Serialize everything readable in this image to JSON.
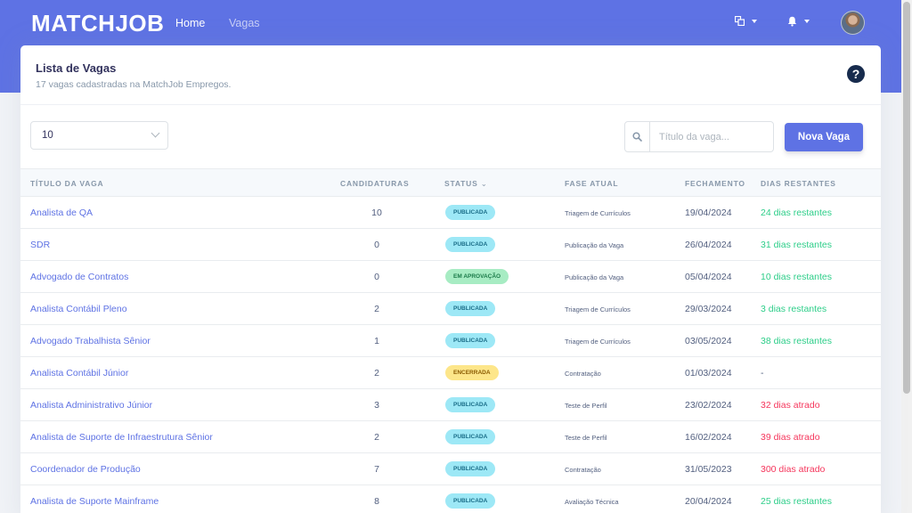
{
  "brand": "MATCHJOB",
  "nav": {
    "home": "Home",
    "vagas": "Vagas"
  },
  "header": {
    "title": "Lista de Vagas",
    "subtitle": "17 vagas cadastradas na MatchJob Empregos."
  },
  "controls": {
    "per_page": "10",
    "search_placeholder": "Título da vaga...",
    "new_button": "Nova Vaga"
  },
  "table": {
    "headers": {
      "title": "TÍTULO DA VAGA",
      "candidaturas": "CANDIDATURAS",
      "status": "STATUS",
      "fase": "FASE ATUAL",
      "fechamento": "FECHAMENTO",
      "dias": "DIAS RESTANTES"
    },
    "rows": [
      {
        "title": "Analista de QA",
        "cand": "10",
        "status": "PUBLICADA",
        "phase": "Triagem de Currículos",
        "date": "19/04/2024",
        "days": "24 dias restantes"
      },
      {
        "title": "SDR",
        "cand": "0",
        "status": "PUBLICADA",
        "phase": "Publicação da Vaga",
        "date": "26/04/2024",
        "days": "31 dias restantes"
      },
      {
        "title": "Advogado de Contratos",
        "cand": "0",
        "status": "EM APROVAÇÃO",
        "phase": "Publicação da Vaga",
        "date": "05/04/2024",
        "days": "10 dias restantes"
      },
      {
        "title": "Analista Contábil Pleno",
        "cand": "2",
        "status": "PUBLICADA",
        "phase": "Triagem de Currículos",
        "date": "29/03/2024",
        "days": "3 dias restantes"
      },
      {
        "title": "Advogado Trabalhista Sênior",
        "cand": "1",
        "status": "PUBLICADA",
        "phase": "Triagem de Currículos",
        "date": "03/05/2024",
        "days": "38 dias restantes"
      },
      {
        "title": "Analista Contábil Júnior",
        "cand": "2",
        "status": "ENCERRADA",
        "phase": "Contratação",
        "date": "01/03/2024",
        "days": "-"
      },
      {
        "title": "Analista Administrativo Júnior",
        "cand": "3",
        "status": "PUBLICADA",
        "phase": "Teste de Perfil",
        "date": "23/02/2024",
        "days": "32 dias atrado"
      },
      {
        "title": "Analista de Suporte de Infraestrutura Sênior",
        "cand": "2",
        "status": "PUBLICADA",
        "phase": "Teste de Perfil",
        "date": "16/02/2024",
        "days": "39 dias atrado"
      },
      {
        "title": "Coordenador de Produção",
        "cand": "7",
        "status": "PUBLICADA",
        "phase": "Contratação",
        "date": "31/05/2023",
        "days": "300 dias atrado"
      },
      {
        "title": "Analista de Suporte Mainframe",
        "cand": "8",
        "status": "PUBLICADA",
        "phase": "Avaliação Técnica",
        "date": "20/04/2024",
        "days": "25 dias restantes"
      }
    ]
  },
  "colors": {
    "primary": "#5e72e4",
    "success": "#2dce89",
    "danger": "#f5365c",
    "badge_published": "#9de8f6",
    "badge_approval": "#a7ecc3",
    "badge_closed": "#fde68a"
  },
  "icons": {
    "dashboard": "windows-icon",
    "notification": "bell-icon",
    "help": "question-circle-icon",
    "search": "search-icon"
  }
}
